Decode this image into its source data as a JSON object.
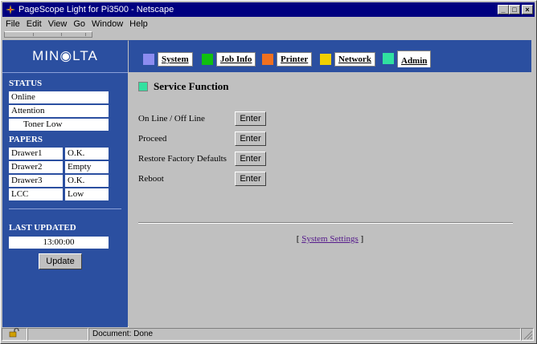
{
  "window": {
    "title": "PageScope Light for Pi3500 - Netscape"
  },
  "menu": [
    "File",
    "Edit",
    "View",
    "Go",
    "Window",
    "Help"
  ],
  "sidebar": {
    "logo": "MIN◉LTA",
    "status_title": "STATUS",
    "status_items": [
      "Online",
      "Attention",
      "Toner Low"
    ],
    "papers_title": "PAPERS",
    "papers": [
      {
        "name": "Drawer1",
        "state": "O.K."
      },
      {
        "name": "Drawer2",
        "state": "Empty"
      },
      {
        "name": "Drawer3",
        "state": "O.K."
      },
      {
        "name": "LCC",
        "state": "Low"
      }
    ],
    "last_updated_title": "LAST UPDATED",
    "last_updated_value": "13:00:00",
    "update_label": "Update"
  },
  "tabs": [
    {
      "label": "System",
      "color": "#8c8cf0"
    },
    {
      "label": "Job Info",
      "color": "#10c010"
    },
    {
      "label": "Printer",
      "color": "#f07020"
    },
    {
      "label": "Network",
      "color": "#f0d000"
    },
    {
      "label": "Admin",
      "color": "#30e0a0"
    }
  ],
  "main": {
    "title": "Service Function",
    "rows": [
      {
        "label": "On Line / Off Line",
        "button": "Enter"
      },
      {
        "label": "Proceed",
        "button": "Enter"
      },
      {
        "label": "Restore Factory Defaults",
        "button": "Enter"
      },
      {
        "label": "Reboot",
        "button": "Enter"
      }
    ],
    "link_open": "[",
    "link_text": "System Settings",
    "link_close": "]"
  },
  "statusbar": {
    "text": "Document: Done"
  }
}
